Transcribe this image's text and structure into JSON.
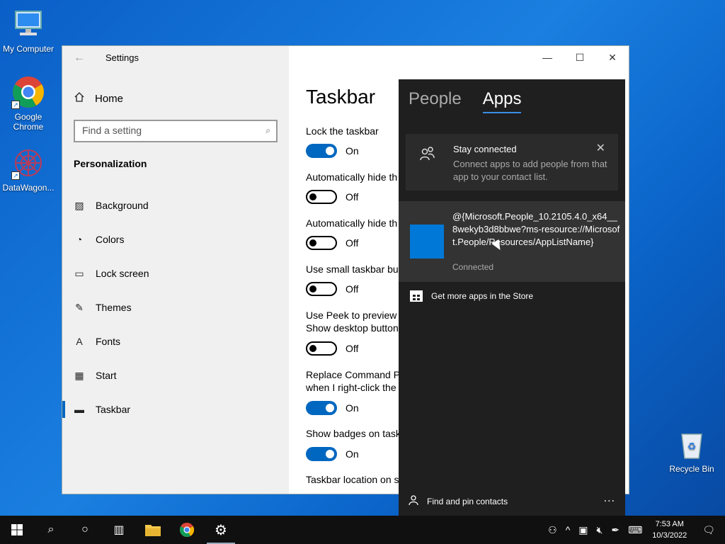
{
  "desktop": {
    "icons": [
      {
        "label": "My Computer"
      },
      {
        "label": "Google Chrome"
      },
      {
        "label": "DataWagon..."
      },
      {
        "label": "Recycle Bin"
      }
    ]
  },
  "settings": {
    "window_title": "Settings",
    "nav": {
      "home": "Home",
      "search_placeholder": "Find a setting",
      "section": "Personalization",
      "items": [
        {
          "label": "Background",
          "icon": "image-icon"
        },
        {
          "label": "Colors",
          "icon": "palette-icon"
        },
        {
          "label": "Lock screen",
          "icon": "lock-screen-icon"
        },
        {
          "label": "Themes",
          "icon": "brush-icon"
        },
        {
          "label": "Fonts",
          "icon": "fonts-icon"
        },
        {
          "label": "Start",
          "icon": "start-icon"
        },
        {
          "label": "Taskbar",
          "icon": "taskbar-icon",
          "active": true
        }
      ]
    },
    "page": {
      "title": "Taskbar",
      "settings": [
        {
          "label": "Lock the taskbar",
          "state": "On"
        },
        {
          "label": "Automatically hide th",
          "state": "Off"
        },
        {
          "label": "Automatically hide th",
          "state": "Off"
        },
        {
          "label": "Use small taskbar but",
          "state": "Off"
        },
        {
          "label": "Use Peek to preview t",
          "label2": "Show desktop button",
          "state": "Off"
        },
        {
          "label": "Replace Command Pr",
          "label2": "when I right-click the",
          "state": "On"
        },
        {
          "label": "Show badges on task",
          "state": "On"
        },
        {
          "label": "Taskbar location on s"
        }
      ]
    }
  },
  "people": {
    "tabs": [
      "People",
      "Apps"
    ],
    "active_tab": "Apps",
    "banner": {
      "title": "Stay connected",
      "text": "Connect apps to add people from that app to your contact list."
    },
    "app": {
      "name": "@{Microsoft.People_10.2105.4.0_x64__8wekyb3d8bbwe?ms-resource://Microsoft.People/Resources/AppListName}",
      "status": "Connected"
    },
    "store_link": "Get more apps in the Store",
    "find_contacts": "Find and pin contacts",
    "more": "..."
  },
  "taskbar": {
    "time": "7:53 AM",
    "date": "10/3/2022"
  },
  "colors": {
    "accent": "#0067c0",
    "desktop": "#0a64c8",
    "flyout": "#1f1f1f"
  }
}
